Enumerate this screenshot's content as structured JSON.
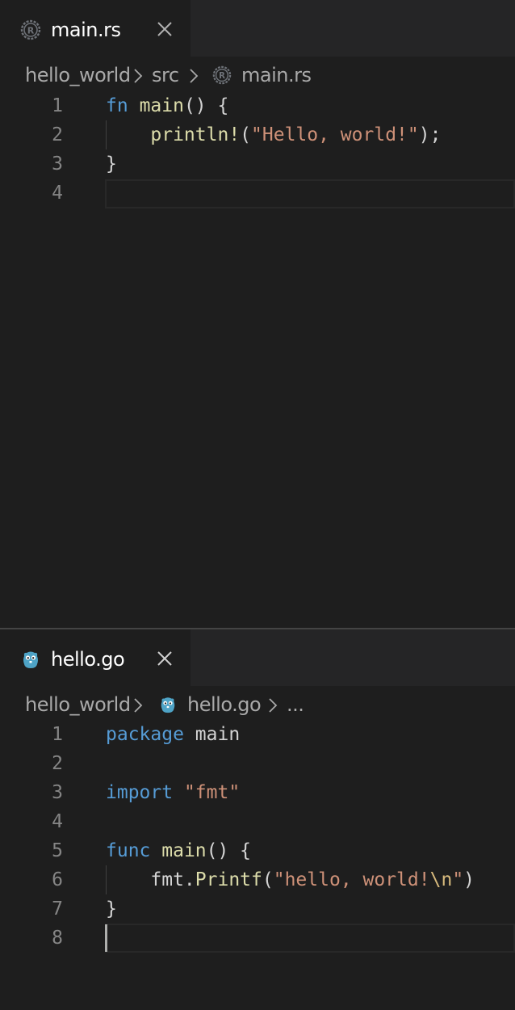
{
  "top_editor": {
    "tab": {
      "label": "main.rs",
      "icon": "rust-icon"
    },
    "breadcrumb": {
      "folder": "hello_world",
      "subfolder": "src",
      "file": "main.rs"
    },
    "lines": [
      {
        "number": "1",
        "tokens": [
          [
            "kw",
            "fn"
          ],
          [
            "pl",
            " "
          ],
          [
            "fn",
            "main"
          ],
          [
            "pl",
            "() {"
          ]
        ]
      },
      {
        "number": "2",
        "tokens": [
          [
            "pl",
            "    "
          ],
          [
            "fn",
            "println!"
          ],
          [
            "pl",
            "("
          ],
          [
            "str",
            "\"Hello, world!\""
          ],
          [
            "pl",
            ");"
          ]
        ]
      },
      {
        "number": "3",
        "tokens": [
          [
            "pl",
            "}"
          ]
        ]
      },
      {
        "number": "4",
        "tokens": []
      }
    ]
  },
  "bottom_editor": {
    "tab": {
      "label": "hello.go",
      "icon": "go-gopher-icon"
    },
    "breadcrumb": {
      "folder": "hello_world",
      "file": "hello.go",
      "more": "..."
    },
    "lines": [
      {
        "number": "1",
        "tokens": [
          [
            "kw",
            "package"
          ],
          [
            "pl",
            " main"
          ]
        ]
      },
      {
        "number": "2",
        "tokens": []
      },
      {
        "number": "3",
        "tokens": [
          [
            "kw",
            "import"
          ],
          [
            "pl",
            " "
          ],
          [
            "str",
            "\"fmt\""
          ]
        ]
      },
      {
        "number": "4",
        "tokens": []
      },
      {
        "number": "5",
        "tokens": [
          [
            "kw",
            "func"
          ],
          [
            "pl",
            " "
          ],
          [
            "fn",
            "main"
          ],
          [
            "pl",
            "() {"
          ]
        ]
      },
      {
        "number": "6",
        "tokens": [
          [
            "pl",
            "    fmt."
          ],
          [
            "fn",
            "Printf"
          ],
          [
            "pl",
            "("
          ],
          [
            "str",
            "\"hello, world!"
          ],
          [
            "esc",
            "\\n"
          ],
          [
            "str",
            "\""
          ],
          [
            "pl",
            ")"
          ]
        ]
      },
      {
        "number": "7",
        "tokens": [
          [
            "pl",
            "}"
          ]
        ]
      },
      {
        "number": "8",
        "tokens": []
      }
    ]
  },
  "colors": {
    "background": "#1e1e1e",
    "keyword": "#569cd6",
    "function": "#dcdcaa",
    "string": "#ce9178",
    "escape": "#d7ba7d",
    "line_number": "#858585"
  }
}
